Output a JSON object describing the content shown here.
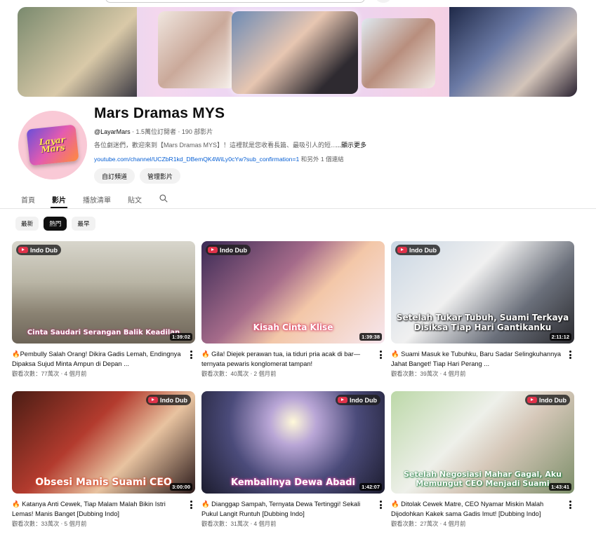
{
  "channel": {
    "name": "Mars Dramas MYS",
    "handle": "@LayarMars",
    "stats": "‧ 1.5萬位訂閱者 ‧ 190 部影片",
    "description": "各位劇迷們，歡迎來到【Mars Dramas MYS】！這裡就是您收看長篇、最吸引人的短...",
    "description_more": "...顯示更多",
    "link_url": "youtube.com/channel/UCZbR1kd_DBemQK4WiLy0cYw?sub_confirmation=1",
    "link_extra": " 和另外 1 個連結",
    "logo_text": "Layar Mars"
  },
  "buttons": {
    "customize": "自訂頻道",
    "manage": "管理影片"
  },
  "tabs": [
    "首頁",
    "影片",
    "播放清單",
    "貼文"
  ],
  "active_tab": "影片",
  "chips": [
    "最新",
    "熱門",
    "最早"
  ],
  "active_chip": "熱門",
  "badge_label": "Indo Dub",
  "videos": [
    {
      "overlay": "Cinta Saudari Serangan Balik Keadilan",
      "duration": "1:39:02",
      "title": "🔥Pembully Salah Orang! Dikira Gadis Lemah, Endingnya Dipaksa Sujud Minta Ampun di Depan ...",
      "meta": "觀看次數：77萬次 ‧ 4 個月前"
    },
    {
      "overlay": "Kisah Cinta Klise",
      "duration": "1:39:38",
      "title": "🔥 Gila! Diejek perawan tua, ia tiduri pria acak di bar—ternyata pewaris konglomerat tampan!",
      "meta": "觀看次數：40萬次 ‧ 2 個月前"
    },
    {
      "overlay": "Setelah Tukar Tubuh, Suami Terkaya Disiksa Tiap Hari Gantikanku",
      "duration": "2:11:12",
      "title": "🔥 Suami Masuk ke Tubuhku, Baru Sadar Selingkuhannya Jahat Banget! Tiap Hari Perang ...",
      "meta": "觀看次數：39萬次 ‧ 4 個月前"
    },
    {
      "overlay": "Obsesi Manis Suami CEO",
      "duration": "3:00:00",
      "title": "🔥 Katanya Anti Cewek, Tiap Malam Malah Bikin Istri Lemas! Manis Banget [Dubbing Indo]",
      "meta": "觀看次數：33萬次 ‧ 5 個月前"
    },
    {
      "overlay": "Kembalinya Dewa Abadi",
      "duration": "1:42:07",
      "title": "🔥 Dianggap Sampah, Ternyata Dewa Tertinggi! Sekali Pukul Langit Runtuh [Dubbing Indo]",
      "meta": "觀看次數：31萬次 ‧ 4 個月前"
    },
    {
      "overlay": "Setelah Negosiasi Mahar Gagal, Aku Memungut CEO Menjadi Suami",
      "duration": "1:43:41",
      "title": "🔥 Ditolak Cewek Matre, CEO Nyamar Miskin Malah Dijodohkan Kakek sama Gadis Imut! [Dubbing Indo]",
      "meta": "觀看次數：27萬次 ‧ 4 個月前"
    }
  ],
  "icons": {
    "search": "search-icon",
    "more": "more-vert-icon",
    "badge": "play-badge-icon"
  },
  "colors": {
    "link": "#065fd4",
    "progress": "#ff0000",
    "chip_active": "#0f0f0f"
  }
}
